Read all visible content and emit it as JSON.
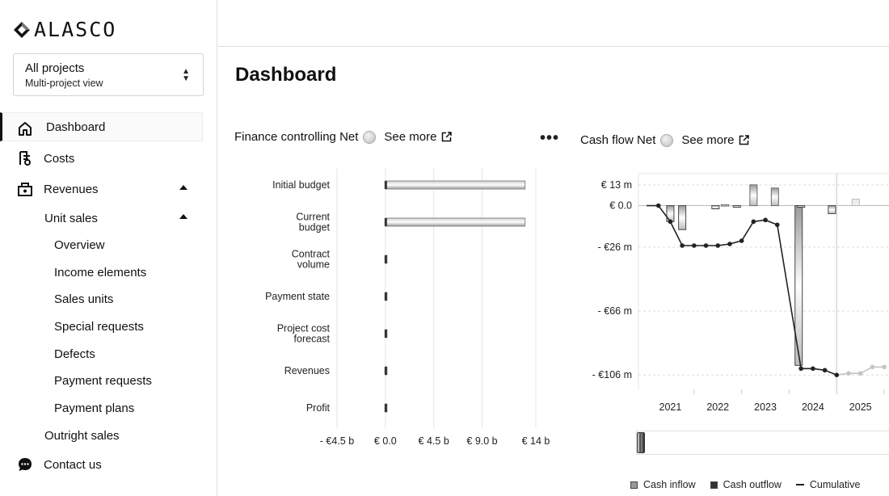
{
  "app": {
    "logo_text": "ALASCO"
  },
  "project_selector": {
    "title": "All projects",
    "subtitle": "Multi-project view"
  },
  "nav": {
    "dashboard": "Dashboard",
    "costs": "Costs",
    "revenues": "Revenues",
    "unit_sales": "Unit sales",
    "unit_sales_items": [
      "Overview",
      "Income elements",
      "Sales units",
      "Special requests",
      "Defects",
      "Payment requests",
      "Payment plans"
    ],
    "outright_sales": "Outright sales",
    "contact_us": "Contact us"
  },
  "page": {
    "title": "Dashboard"
  },
  "finance_card": {
    "title": "Finance controlling Net",
    "see_more": "See more",
    "menu": "•••"
  },
  "cashflow_card": {
    "title": "Cash flow Net",
    "see_more": "See more"
  },
  "chart_data": [
    {
      "type": "bar",
      "orientation": "horizontal",
      "title": "Finance controlling Net",
      "categories": [
        "Initial budget",
        "Current budget",
        "Contract volume",
        "Payment state",
        "Project cost forecast",
        "Revenues",
        "Profit"
      ],
      "category_lines": [
        [
          "Initial budget"
        ],
        [
          "Current",
          "budget"
        ],
        [
          "Contract",
          "volume"
        ],
        [
          "Payment state"
        ],
        [
          "Project cost",
          "forecast"
        ],
        [
          "Revenues"
        ],
        [
          "Profit"
        ]
      ],
      "values": [
        13.0,
        13.0,
        0.0,
        0.05,
        0.1,
        0.05,
        0.0
      ],
      "unit": "€ b",
      "xlim": [
        -4.5,
        14
      ],
      "x_ticks": [
        -4.5,
        0,
        4.5,
        9,
        14
      ],
      "x_tick_labels": [
        "- €4.5 b",
        "€ 0.0",
        "€ 4.5 b",
        "€ 9.0 b",
        "€ 14 b"
      ],
      "grid": true
    },
    {
      "type": "bar+line",
      "title": "Cash flow Net",
      "unit": "€ m",
      "x_ticks": [
        2021,
        2022,
        2023,
        2024,
        2025
      ],
      "x_tick_labels": [
        "2021",
        "2022",
        "2023",
        "2024",
        "2025"
      ],
      "xlim": [
        2020.5,
        2025.6
      ],
      "ylim": [
        -115,
        20
      ],
      "y_ticks": [
        13,
        0,
        -26,
        -66,
        -106
      ],
      "y_tick_labels": [
        "€ 13 m",
        "€ 0.0",
        "- €26 m",
        "- €66 m",
        "- €106 m"
      ],
      "series": [
        {
          "name": "Cash inflow",
          "x": [
            2022.15,
            2022.75,
            2023.2,
            2024.9
          ],
          "values": [
            0.5,
            13,
            11,
            4
          ]
        },
        {
          "name": "Cash outflow",
          "x": [
            2021.0,
            2021.25,
            2021.95,
            2022.4,
            2023.7,
            2023.75,
            2024.4
          ],
          "values": [
            -10,
            -15,
            -2,
            -1,
            -100,
            -1,
            -5
          ]
        },
        {
          "name": "Cumulative",
          "x": [
            2020.5,
            2020.75,
            2021.0,
            2021.25,
            2021.5,
            2021.75,
            2022.0,
            2022.25,
            2022.5,
            2022.75,
            2023.0,
            2023.25,
            2023.75,
            2024.0,
            2024.25,
            2024.5,
            2024.75,
            2025.0,
            2025.25,
            2025.5
          ],
          "values": [
            0,
            0,
            -10,
            -25,
            -25,
            -25,
            -25,
            -24,
            -22,
            -10,
            -9,
            -12,
            -102,
            -102,
            -103,
            -106,
            -105,
            -105,
            -101,
            -101
          ]
        }
      ],
      "forecast_from": 2024.5,
      "legend_position": "bottom"
    }
  ],
  "legend": {
    "inflow": "Cash inflow",
    "outflow": "Cash outflow",
    "cumulative": "Cumulative"
  }
}
